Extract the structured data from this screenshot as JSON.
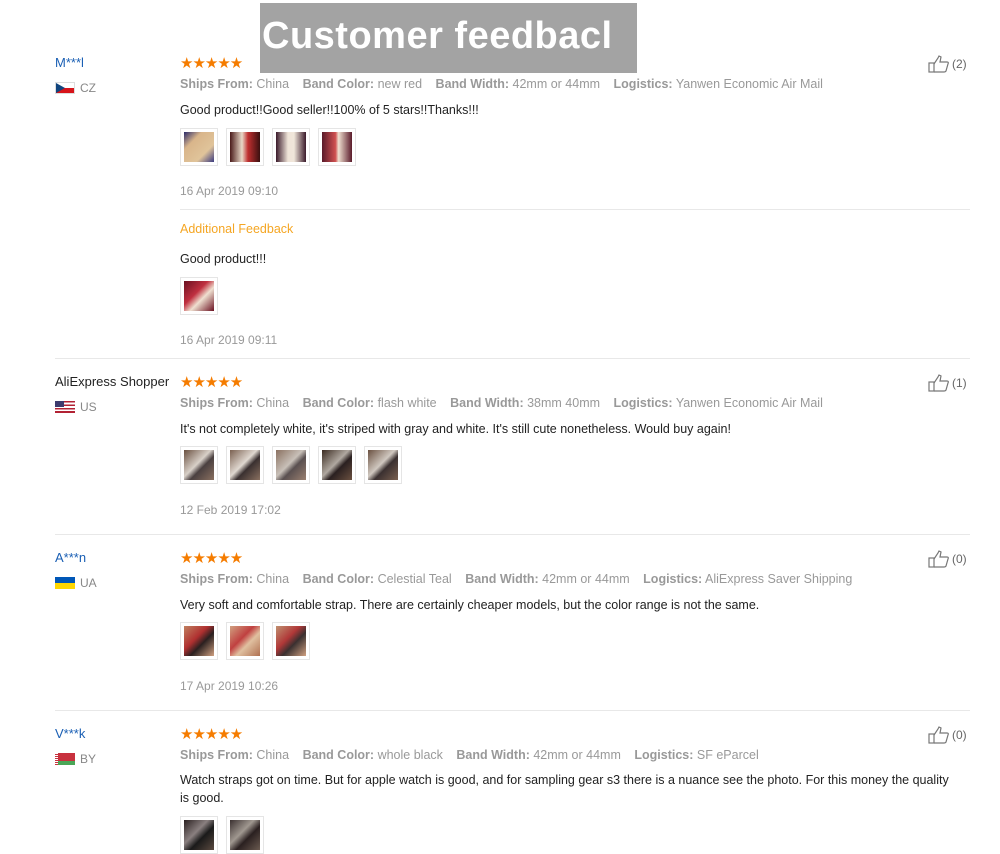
{
  "banner": {
    "title": "Customer feedbacl"
  },
  "labels": {
    "ships_from": "Ships From:",
    "band_color": "Band Color:",
    "band_width": "Band Width:",
    "logistics": "Logistics:",
    "additional_feedback": "Additional Feedback"
  },
  "stars_text": "★★★★★",
  "reviews": [
    {
      "user": "M***l",
      "country": "CZ",
      "rating": 5,
      "ships_from": "China",
      "band_color": "new red",
      "band_width": "42mm or 44mm",
      "logistics": "Yanwen Economic Air Mail",
      "comment": "Good product!!Good seller!!100% of 5 stars!!Thanks!!!",
      "date": "16 Apr 2019 09:10",
      "helpful": "(2)",
      "additional": {
        "comment": "Good product!!!",
        "date": "16 Apr 2019 09:11"
      }
    },
    {
      "user": "AliExpress Shopper",
      "country": "US",
      "rating": 5,
      "ships_from": "China",
      "band_color": "flash white",
      "band_width": "38mm 40mm",
      "logistics": "Yanwen Economic Air Mail",
      "comment": "It's not completely white, it's striped with gray and white. It's still cute nonetheless. Would buy again!",
      "date": "12 Feb 2019 17:02",
      "helpful": "(1)"
    },
    {
      "user": "A***n",
      "country": "UA",
      "rating": 5,
      "ships_from": "China",
      "band_color": "Celestial Teal",
      "band_width": "42mm or 44mm",
      "logistics": "AliExpress Saver Shipping",
      "comment": "Very soft and comfortable strap. There are certainly cheaper models, but the color range is not the same.",
      "date": "17 Apr 2019 10:26",
      "helpful": "(0)"
    },
    {
      "user": "V***k",
      "country": "BY",
      "rating": 5,
      "ships_from": "China",
      "band_color": "whole black",
      "band_width": "42mm or 44mm",
      "logistics": "SF eParcel",
      "comment": "Watch straps got on time. But for apple watch is good, and for sampling gear s3 there is a nuance see the photo. For this money the quality is good.",
      "helpful": "(0)"
    }
  ],
  "colors": {
    "link": "#1a5fb4",
    "star": "#f57c00",
    "additional": "#f5a623",
    "muted": "#999999"
  }
}
